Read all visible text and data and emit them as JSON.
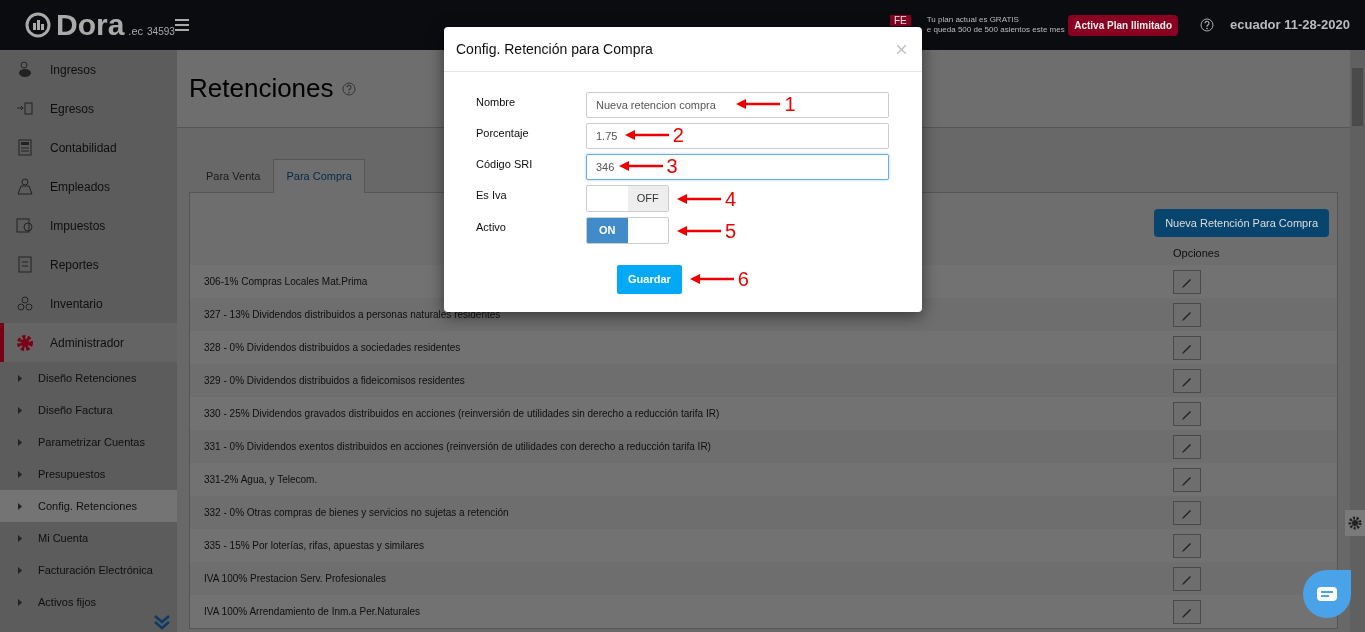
{
  "topbar": {
    "logo": "Dora",
    "logo_suffix": ".ec",
    "account": "34593",
    "plan_badge": "FE",
    "plan_lines": [
      "Tu plan actual es GRATIS",
      "e queda 500 de 500 asientos este mes"
    ],
    "upgrade_button": "Activa Plan Ilimitado",
    "user": "ecuador 11-28-2020"
  },
  "sidebar": {
    "items": [
      {
        "label": "Ingresos",
        "selected": false
      },
      {
        "label": "Egresos",
        "selected": false
      },
      {
        "label": "Contabilidad",
        "selected": false
      },
      {
        "label": "Empleados",
        "selected": false
      },
      {
        "label": "Impuestos",
        "selected": false
      },
      {
        "label": "Reportes",
        "selected": false
      },
      {
        "label": "Inventario",
        "selected": false
      },
      {
        "label": "Administrador",
        "selected": true,
        "children": [
          {
            "label": "Diseño Retenciones",
            "selected": false
          },
          {
            "label": "Diseño Factura",
            "selected": false
          },
          {
            "label": "Parametrizar Cuentas",
            "selected": false
          },
          {
            "label": "Presupuestos",
            "selected": false
          },
          {
            "label": "Config. Retenciones",
            "selected": true
          },
          {
            "label": "Mi Cuenta",
            "selected": false
          },
          {
            "label": "Facturación Electrónica",
            "selected": false
          },
          {
            "label": "Activos fijos",
            "selected": false
          }
        ]
      }
    ]
  },
  "page": {
    "title": "Retenciones",
    "tabs": [
      {
        "label": "Para Venta",
        "selected": false
      },
      {
        "label": "Para Compra",
        "selected": true
      }
    ],
    "new_button": "Nueva Retención Para Compra",
    "options_header": "Opciones",
    "rows": [
      "306-1% Compras Locales Mat.Prima",
      "327 - 13% Dividendos distribuidos a personas naturales residentes",
      "328 - 0% Dividendos distribuidos a sociedades residentes",
      "329 - 0% Dividendos distribuidos a fideicomisos residentes",
      "330 - 25% Dividendos gravados distribuidos en acciones (reinversión de utilidades sin derecho a reducción tarifa IR)",
      "331 - 0% Dividendos exentos distribuidos en acciones (reinversión de utilidades con derecho a reducción tarifa IR)",
      "331-2% Agua, y Telecom.",
      "332 - 0% Otras compras de bienes y servicios no sujetas a retención",
      "335 - 15% Por loterías, rifas, apuestas y similares",
      "IVA 100% Prestacion Serv. Profesionales",
      "IVA 100% Arrendamiento de Inm.a Per.Naturales"
    ]
  },
  "modal": {
    "title": "Config. Retención para Compra",
    "fields": [
      {
        "kind": "text",
        "label": "Nombre",
        "value": "Nueva retencion compra",
        "focused": false,
        "annotation": "1"
      },
      {
        "kind": "text",
        "label": "Porcentaje",
        "value": "1.75",
        "focused": false,
        "annotation": "2"
      },
      {
        "kind": "text",
        "label": "Código SRI",
        "value": "346",
        "focused": true,
        "annotation": "3"
      },
      {
        "kind": "toggle",
        "label": "Es Iva",
        "on": false,
        "state_text": "OFF",
        "annotation": "4"
      },
      {
        "kind": "toggle",
        "label": "Activo",
        "on": true,
        "state_text": "ON",
        "annotation": "5"
      }
    ],
    "save_button": "Guardar",
    "save_annotation": "6"
  }
}
